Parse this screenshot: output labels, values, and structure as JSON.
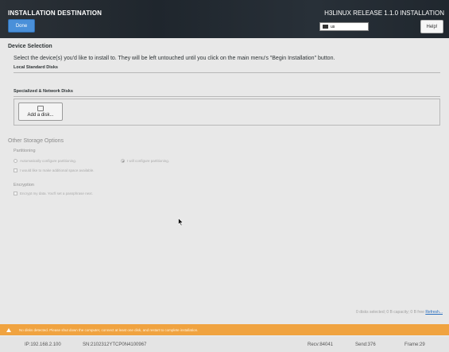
{
  "header": {
    "title": "INSTALLATION DESTINATION",
    "done_label": "Done",
    "release": "H3LINUX RELEASE 1.1.0 INSTALLATION",
    "keyboard_layout": "us",
    "help_label": "Help!",
    "background_color": "#252c33",
    "done_color": "#4a90d9"
  },
  "device_selection": {
    "title": "Device Selection",
    "description": "Select the device(s) you'd like to install to.  They will be left untouched until you click on the main menu's \"Begin Installation\" button.",
    "local_label": "Local Standard Disks",
    "specialized_label": "Specialized & Network Disks",
    "add_disk_label": "Add a disk..."
  },
  "other_storage": {
    "title": "Other Storage Options",
    "partitioning_label": "Partitioning",
    "auto_label": "Automatically configure partitioning.",
    "manual_label": "I will configure partitioning.",
    "manual_selected": true,
    "additional_space_label": "I would like to make additional space available.",
    "encryption_label": "Encryption",
    "encrypt_label": "Encrypt my data. You'll set a passphrase next."
  },
  "status": {
    "disk_summary": "0 disks selected; 0 B capacity; 0 B free",
    "refresh_label": "Refresh...",
    "warning": "No disks detected.  Please shut down the computer, connect at least one disk, and restart to complete installation.",
    "warning_color": "#f0a340"
  },
  "footer": {
    "ip": "IP:192.168.2.100",
    "sn": "SN:2102312YTCP0N4100967",
    "recv": "Recv:84041",
    "send": "Send:376",
    "frame": "Frame:29"
  }
}
